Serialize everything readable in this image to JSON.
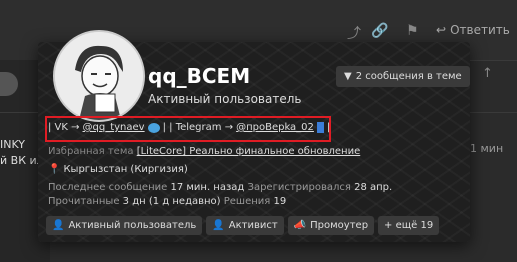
{
  "background": {
    "reply_label": "Ответить",
    "left_text_1": "INKY",
    "left_text_2": "й ВК или",
    "time": "1 мин"
  },
  "profile": {
    "username": "qq_BCEM",
    "user_title": "Активный пользователь",
    "messages_button": "2 сообщения в теме",
    "links": {
      "prefix": "| VK →",
      "vk_handle": "@qq_tynaev",
      "middle": "| | Telegram →",
      "tg_handle": "@проBepka_02",
      "suffix": "|"
    },
    "favorite_theme": {
      "label": "Избранная тема",
      "value": "[LiteCore] Реально финальное обновление"
    },
    "location": "Кыргызстан (Киргизия)",
    "last_message_label": "Последнее сообщение",
    "last_message_value": "17 мин. назад",
    "registered_label": "Зарегистрировался",
    "registered_value": "28 апр.",
    "reading_label": "Прочитанные",
    "reading_value": "3 дн (1 д недавно)",
    "solutions_label": "Решения",
    "solutions_value": "19",
    "badges": [
      {
        "label": "Активный пользователь",
        "icon": "user-icon"
      },
      {
        "label": "Активист",
        "icon": "user-plus-icon"
      },
      {
        "label": "Промоутер",
        "icon": "megaphone-icon"
      },
      {
        "label": "+ ещё 19",
        "icon": ""
      }
    ]
  },
  "colors": {
    "highlight_border": "#e01c24",
    "card_bg": "#1f1f1f"
  }
}
